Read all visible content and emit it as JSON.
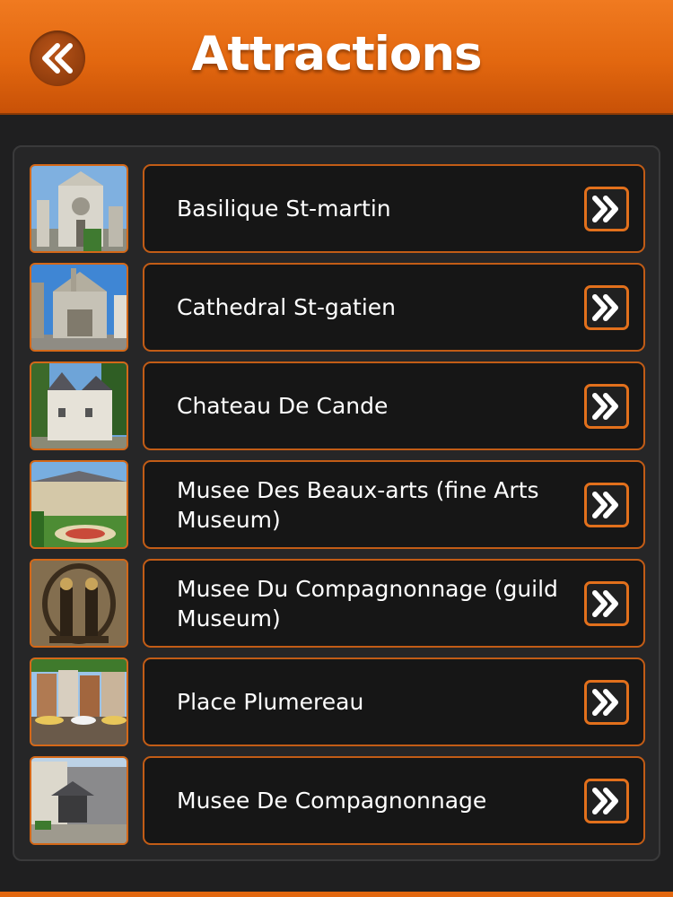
{
  "header": {
    "title": "Attractions",
    "back_icon": "double-chevron-left-icon"
  },
  "items": [
    {
      "label": "Basilique St-martin",
      "thumbnail": "basilica-photo"
    },
    {
      "label": "Cathedral St-gatien",
      "thumbnail": "cathedral-photo"
    },
    {
      "label": "Chateau De Cande",
      "thumbnail": "chateau-photo"
    },
    {
      "label": "Musee Des Beaux-arts (fine Arts Museum)",
      "thumbnail": "museum-garden-photo"
    },
    {
      "label": "Musee Du Compagnonnage (guild Museum)",
      "thumbnail": "guild-sculpture-photo"
    },
    {
      "label": "Place Plumereau",
      "thumbnail": "square-photo"
    },
    {
      "label": "Musee De Compagnonnage",
      "thumbnail": "courtyard-photo"
    }
  ],
  "row_arrow_icon": "double-chevron-right-icon",
  "colors": {
    "accent": "#e2670f",
    "background": "#1f1f20",
    "button": "#161616"
  }
}
